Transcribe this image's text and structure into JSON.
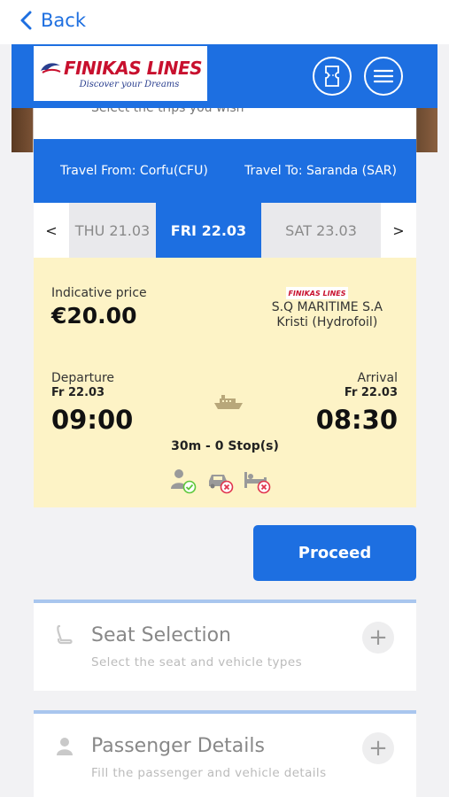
{
  "nav": {
    "back_label": "Back"
  },
  "header": {
    "brand": "FINIKAS LINES",
    "tagline": "Discover your Dreams",
    "icons": [
      "ticket-icon",
      "menu-icon"
    ]
  },
  "search": {
    "partial_text": "Select the trips you wish",
    "travel_from": "Travel From: Corfu(CFU)",
    "travel_to": "Travel To: Saranda (SAR)"
  },
  "dates": {
    "prev_arrow": "<",
    "next_arrow": ">",
    "prev": "THU 21.03",
    "selected": "FRI 22.03",
    "next": "SAT 23.03"
  },
  "trip": {
    "price_label": "Indicative price",
    "price": "€20.00",
    "operator_logo": "FINIKAS LINES",
    "operator": "S.Q MARITIME S.A",
    "vessel": "Kristi (Hydrofoil)",
    "departure_label": "Departure",
    "departure_date": "Fr 22.03",
    "departure_time": "09:00",
    "arrival_label": "Arrival",
    "arrival_date": "Fr 22.03",
    "arrival_time": "08:30",
    "duration": "30m - 0 Stop(s)",
    "amenities": [
      {
        "icon": "passenger-icon",
        "status": "available"
      },
      {
        "icon": "car-icon",
        "status": "unavailable"
      },
      {
        "icon": "cabin-bed-icon",
        "status": "unavailable"
      }
    ]
  },
  "actions": {
    "proceed_label": "Proceed"
  },
  "sections": [
    {
      "title": "Seat Selection",
      "subtitle": "Select the seat and vehicle types",
      "icon": "seat-icon",
      "toggle": "+"
    },
    {
      "title": "Passenger Details",
      "subtitle": "Fill the passenger and vehicle details",
      "icon": "person-icon",
      "toggle": "+"
    }
  ],
  "colors": {
    "primary": "#1d6fe1",
    "card_bg": "#fdf3c6",
    "brand_red": "#c8102e",
    "ok": "#5cc73a",
    "no": "#e0344d"
  }
}
